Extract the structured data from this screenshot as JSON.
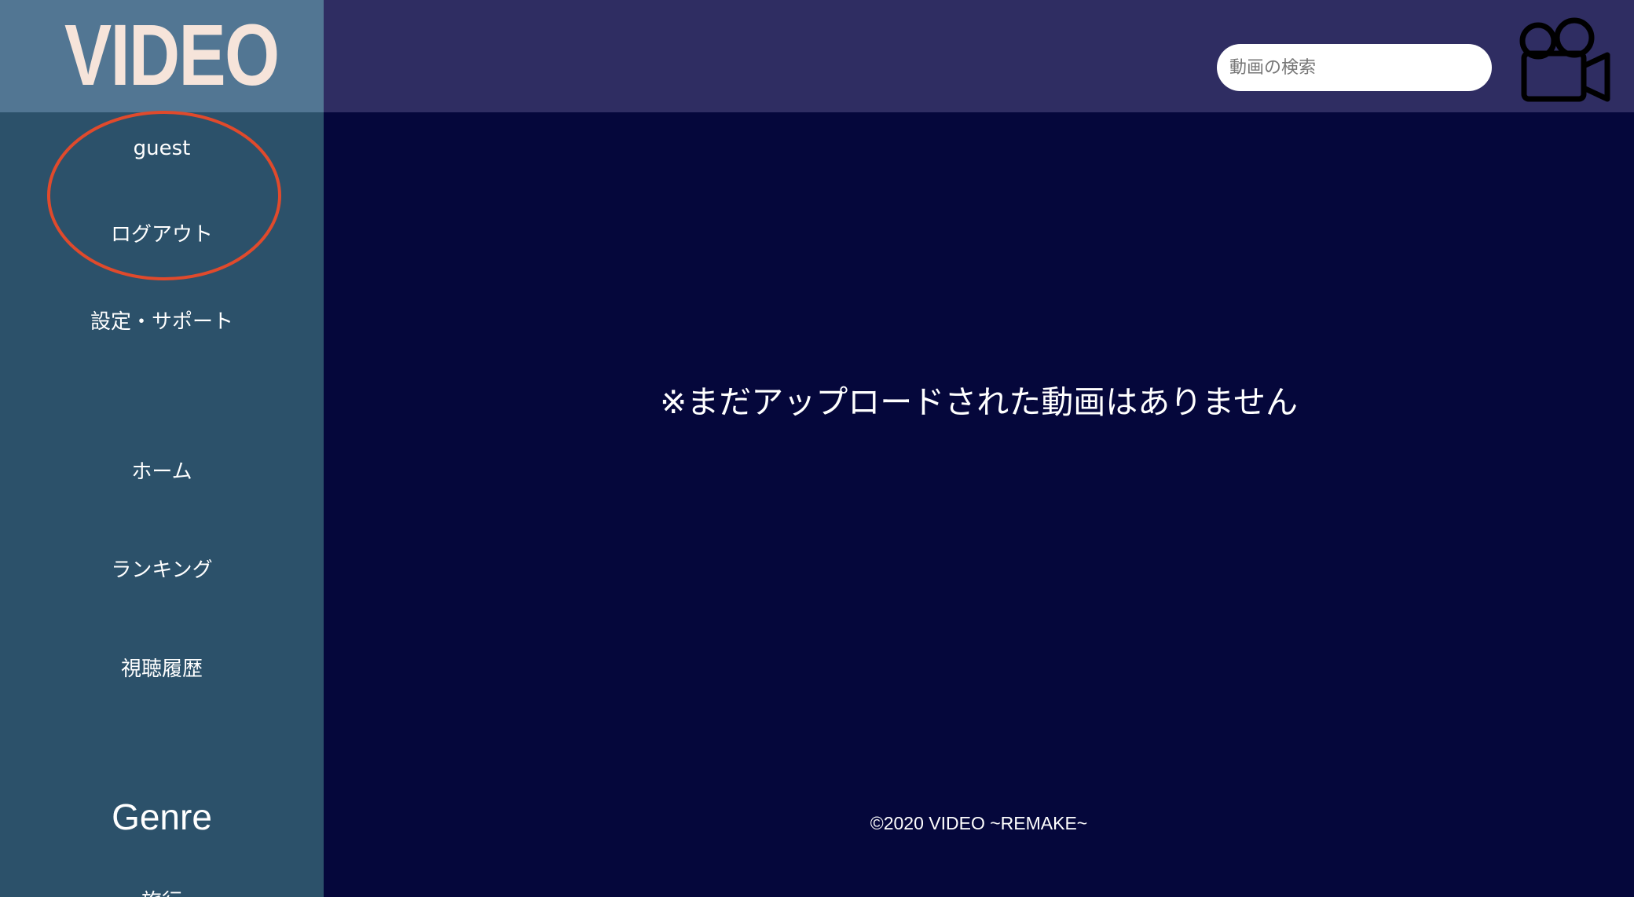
{
  "header": {
    "logo": "VIDEO",
    "search_placeholder": "動画の検索",
    "camera_icon": "movie-camera-icon"
  },
  "sidebar": {
    "user": "guest",
    "logout": "ログアウト",
    "settings": "設定・サポート",
    "home": "ホーム",
    "ranking": "ランキング",
    "history": "視聴履歴",
    "genre_heading": "Genre",
    "genre_first_item": "旅行"
  },
  "main": {
    "empty_message": "※まだアップロードされた動画はありません"
  },
  "footer": {
    "copyright": "©2020 VIDEO ~REMAKE~"
  },
  "colors": {
    "header_bg": "#2f2d62",
    "logo_bg": "#527693",
    "logo_text": "#f6e4da",
    "sidebar_bg": "#2c516a",
    "main_bg": "#05073b",
    "annotation": "#e04a2c"
  }
}
